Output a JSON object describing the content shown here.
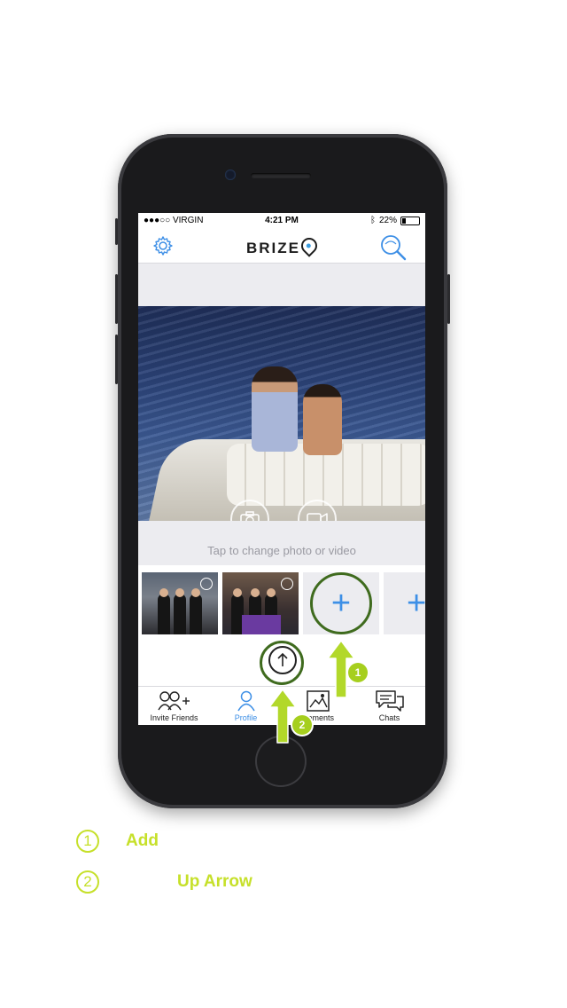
{
  "status_bar": {
    "carrier": "●●●○○ VIRGIN",
    "time": "4:21 PM",
    "battery": "22%"
  },
  "nav": {
    "logo": "BRIZE"
  },
  "photo": {
    "caption": "Tap to change photo or video"
  },
  "tabs": [
    {
      "label": "Invite Friends",
      "icon": "invite-friends-icon"
    },
    {
      "label": "Profile",
      "icon": "profile-icon",
      "active": true
    },
    {
      "label": "Moments",
      "icon": "moments-icon"
    },
    {
      "label": "Chats",
      "icon": "chats-icon"
    }
  ],
  "annotations": [
    {
      "number": "1",
      "label": "Add"
    },
    {
      "number": "2",
      "label": "Up Arrow"
    }
  ],
  "colors": {
    "accent": "#3d8fe6",
    "annotation": "#a6cf1e",
    "ring": "#3f6b1e"
  }
}
